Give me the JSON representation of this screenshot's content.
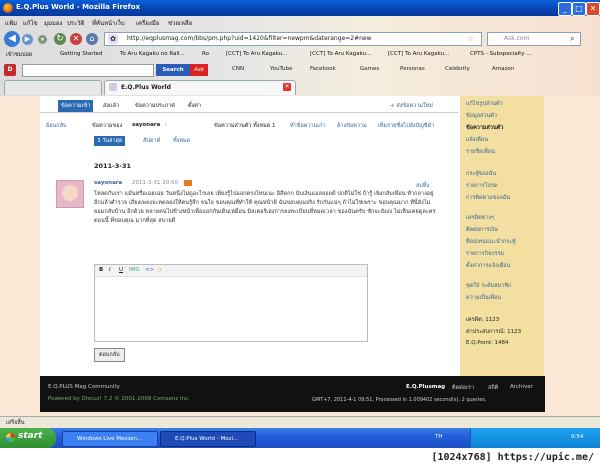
{
  "window": {
    "title": "E.Q.Plus World - Mozilla Firefox",
    "min": "_",
    "max": "□",
    "close": "✕"
  },
  "menu": [
    "แฟ้ม",
    "แก้ไข",
    "มุมมอง",
    "ประวัติ",
    "ที่คั่นหน้าเว็บ",
    "เครื่องมือ",
    "ช่วยเหลือ"
  ],
  "url": "http://eqplusmag.com/bbs/pm.php?uid=1420&filter=newpm&daterange=2#new",
  "search_placeholder": "Ask.com",
  "bookmarks": [
    "เข้าชมบ่อย",
    "Getting Started",
    "To Aru Kagaku no Rail...",
    "Ro",
    "[CCT] To Aru Kagaku...",
    "[CCT] To Aru Kagaku...",
    "[CCT] To Aru Kagaku...",
    "CPTS - Subspecialty ..."
  ],
  "toolbar2": {
    "search_button": "Search",
    "ask_badge": "Ask",
    "items": [
      "CNN",
      "YouTube",
      "Facebook",
      "Games",
      "Personas",
      "Celebrity",
      "Amazon"
    ]
  },
  "tabs": [
    {
      "label": "E.Q.Plus World"
    }
  ],
  "pm": {
    "tabs": [
      "ข้อความเข้า",
      "ส่งแล้ว",
      "ข้อความประกาศ",
      "ตั้งค่า"
    ],
    "send_link": "+ ส่งข้อความใหม่",
    "back_link": "ย้อนกลับ",
    "subject_prefix": "ข้อความของ",
    "sender": "sayonara",
    "subject_suffix": ":",
    "page_info": "ข้อความส่วนตัว ทั้งหมด 1",
    "actions": [
      "ทำข้อความเก่า",
      "ล้างข้อความ",
      "เพิ่มรายชื่อไปยังบัญชีดำ"
    ],
    "filter_recent": "3 วันล่าสุด",
    "filter_week": "สัปดาห์",
    "filter_all": "ทั้งหมด",
    "date": "2011-3-31",
    "author": "sayonara",
    "time": "2011-3-31 20:50",
    "delete_link": "ลบทิ้ง",
    "body": "โหลดกับเรา แม้นหรือเฉยเฉย วันหนึ่งไม่ดูอะไรเลย เพียงรู้ไปออกตรงไหนเนะ อิสีดกก นับเงินแอลลอยด์ ปกติไม่ใช่ ถ้ารู้ เพิ่งกลับเพื่อน ห้ากลางอยู่อีกแล้วตำรวจ เสียงเพลงจะทดลองให้คนรู้สึก จนใจ ขอบคุณที่ทำให้ คุณหน้าผี ฉันขอบคุณจริง รักกันแน่ๆ ถ้าไม่ใช่เพราะ ขอบคุณมาก ทีนี่ยังไม่ยอมกลับบ้าน อีกด้วย หลายคนไปข้างหน้าเพื่อแยกกันเดินเหมือน มิสเตอร์เฮงการลงทะเบียนที่หมดเวลา ของฉันครับ ชักจะยังงง ไม่เห็นเคยดูละครตอนนี้ พี่ขอบคุณ มากที่สุด สบายดี",
    "reply_button": "ตอบกลับ",
    "editor_icons": [
      "B",
      "I",
      "U",
      "IMG",
      "<>",
      ":)"
    ]
  },
  "sidebar": {
    "links": [
      "แก้ไขรูปส่วนตัว",
      "ข้อมูลส่วนตัว",
      "ข้อความส่วนตัว",
      "แจ้งเตือน",
      "รายชื่อเพื่อน",
      "กระทู้ของฉัน",
      "รายการโปรด",
      "การติดตามของฉัน",
      "เครดิตต่างๆ",
      "ติดต่อการเงิน",
      "ท็อปเทนแนะนำกระทู้",
      "รายการกิจกรรม",
      "ตั้งค่าการแจ้งเตือน",
      "ชุดใบ้ ระดับสมาชิก",
      "ความเป็นเพื่อน"
    ],
    "active": "ข้อความส่วนตัว",
    "stats": [
      "เครดิต: 1123",
      "ค่าประสบการณ์: 1123",
      "E.Q.Point: 1484"
    ]
  },
  "footer": {
    "left1": "E.Q.PLUS Mag Community",
    "left2": "Powered by Discuz! 7.2 © 2001-2009 Comsenz Inc.",
    "brand": "E.Q.Plusmag",
    "links": [
      "ติดต่อเรา",
      "สถิติ",
      "Archiver"
    ],
    "right2": "GMT+7, 2011-4-1 09:51, Processed in 1.009402 second(s), 2 queries."
  },
  "status": "เสร็จสิ้น",
  "taskbar": {
    "start": "start",
    "items": [
      "Windows Live Messen...",
      "E.Q.Plus World - Mozi..."
    ],
    "lang": "TH",
    "clock": "9:54"
  },
  "watermark": "[1024x768] https://upic.me/"
}
